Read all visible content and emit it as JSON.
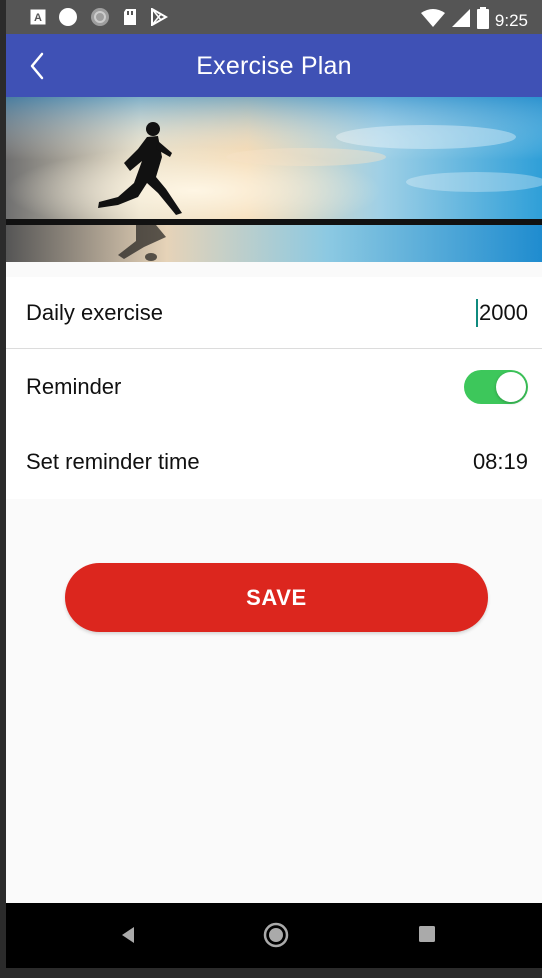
{
  "status_bar": {
    "time": "9:25",
    "icons": [
      "a-icon",
      "circle-icon",
      "sync-icon",
      "sd-card-icon",
      "play-store-icon",
      "wifi-icon",
      "signal-icon",
      "battery-icon"
    ]
  },
  "app_bar": {
    "title": "Exercise Plan",
    "background": "#3f51b5",
    "back_icon": "chevron-left-icon"
  },
  "hero": {
    "icon": "runner-silhouette-icon"
  },
  "settings": {
    "daily_exercise": {
      "label": "Daily exercise",
      "value": "2000"
    },
    "reminder": {
      "label": "Reminder",
      "enabled": true,
      "toggle_color": "#3dc75b"
    },
    "reminder_time": {
      "label": "Set reminder time",
      "value": "08:19"
    }
  },
  "save_button": {
    "label": "SAVE",
    "color": "#dc261e"
  },
  "nav_bar": {
    "icons": [
      "back-triangle-icon",
      "home-circle-icon",
      "recents-square-icon"
    ]
  }
}
